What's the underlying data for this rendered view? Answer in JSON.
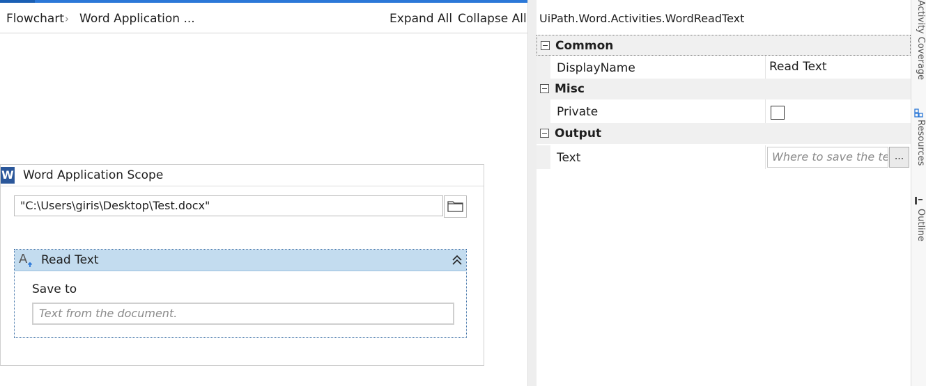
{
  "breadcrumb": {
    "items": [
      "Flowchart",
      "Word Application ..."
    ],
    "separator": "›"
  },
  "toolbar": {
    "expand_all": "Expand All",
    "collapse_all": "Collapse All"
  },
  "scope": {
    "title": "Word Application Scope",
    "icon": "W",
    "file_path": "\"C:\\Users\\giris\\Desktop\\Test.docx\""
  },
  "read_text": {
    "title": "Read Text",
    "save_to_label": "Save to",
    "save_to_placeholder": "Text from the document."
  },
  "properties": {
    "title": "UiPath.Word.Activities.WordReadText",
    "categories": [
      {
        "name": "Common",
        "rows": [
          {
            "name": "DisplayName",
            "value": "Read Text"
          }
        ]
      },
      {
        "name": "Misc",
        "rows": [
          {
            "name": "Private",
            "checked": false
          }
        ]
      },
      {
        "name": "Output",
        "rows": [
          {
            "name": "Text",
            "placeholder": "Where to save the te",
            "button": "..."
          }
        ]
      }
    ]
  },
  "side_panel": {
    "tabs": [
      "Activity Coverage",
      "Resources",
      "Outline"
    ]
  },
  "colors": {
    "accent": "#2b78d8",
    "word_blue": "#2b579a",
    "activity_header": "#c3dcef"
  }
}
